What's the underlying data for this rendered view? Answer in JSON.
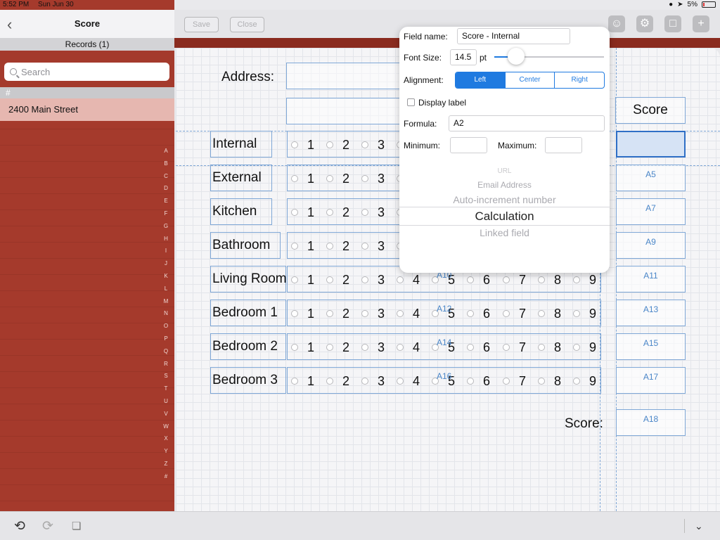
{
  "status": {
    "time": "5:52 PM",
    "date": "Sun Jun 30",
    "battery": "5%"
  },
  "sidebar": {
    "title": "Score",
    "records_label": "Records (1)",
    "search_placeholder": "Search",
    "section_header": "#",
    "records": [
      "2400 Main Street"
    ],
    "index_letters": [
      "A",
      "B",
      "C",
      "D",
      "E",
      "F",
      "G",
      "H",
      "I",
      "J",
      "K",
      "L",
      "M",
      "N",
      "O",
      "P",
      "Q",
      "R",
      "S",
      "T",
      "U",
      "V",
      "W",
      "X",
      "Y",
      "Z",
      "#"
    ]
  },
  "toolbar": {
    "save_label": "Save",
    "close_label": "Close",
    "icons": [
      "person-gear-icon",
      "gear-icon",
      "document-icon",
      "plus-icon"
    ]
  },
  "form": {
    "address_label": "Address:",
    "score_header": "Score",
    "score_label": "Score:",
    "rows": [
      {
        "label": "Internal",
        "tag": "",
        "score": ""
      },
      {
        "label": "External",
        "tag": "",
        "score": "A5"
      },
      {
        "label": "Kitchen",
        "tag": "",
        "score": "A7"
      },
      {
        "label": "Bathroom",
        "tag": "",
        "score": "A9"
      },
      {
        "label": "Living Room",
        "tag": "A10",
        "score": "A11"
      },
      {
        "label": "Bedroom 1",
        "tag": "A12",
        "score": "A13"
      },
      {
        "label": "Bedroom 2",
        "tag": "A14",
        "score": "A15"
      },
      {
        "label": "Bedroom 3",
        "tag": "A16",
        "score": "A17"
      }
    ],
    "options": [
      "1",
      "2",
      "3",
      "4",
      "5",
      "6",
      "7",
      "8",
      "9"
    ],
    "total_score": "A18"
  },
  "popover": {
    "field_name_label": "Field name:",
    "field_name_value": "Score - Internal",
    "font_size_label": "Font Size:",
    "font_size_value": "14.5",
    "font_size_unit": "pt",
    "font_size_slider_fraction": 0.2,
    "alignment_label": "Alignment:",
    "alignment_options": [
      "Left",
      "Center",
      "Right"
    ],
    "alignment_selected": "Left",
    "display_label": "Display label",
    "formula_label": "Formula:",
    "formula_value": "A2",
    "minimum_label": "Minimum:",
    "maximum_label": "Maximum:",
    "field_types": [
      "URL",
      "Email Address",
      "Auto-increment number",
      "Calculation",
      "Linked field"
    ],
    "field_type_selected": "Calculation"
  },
  "colors": {
    "accent": "#1f7ae0",
    "sidebar_red": "#a43a2c",
    "guide_blue": "#7fa7d6"
  }
}
